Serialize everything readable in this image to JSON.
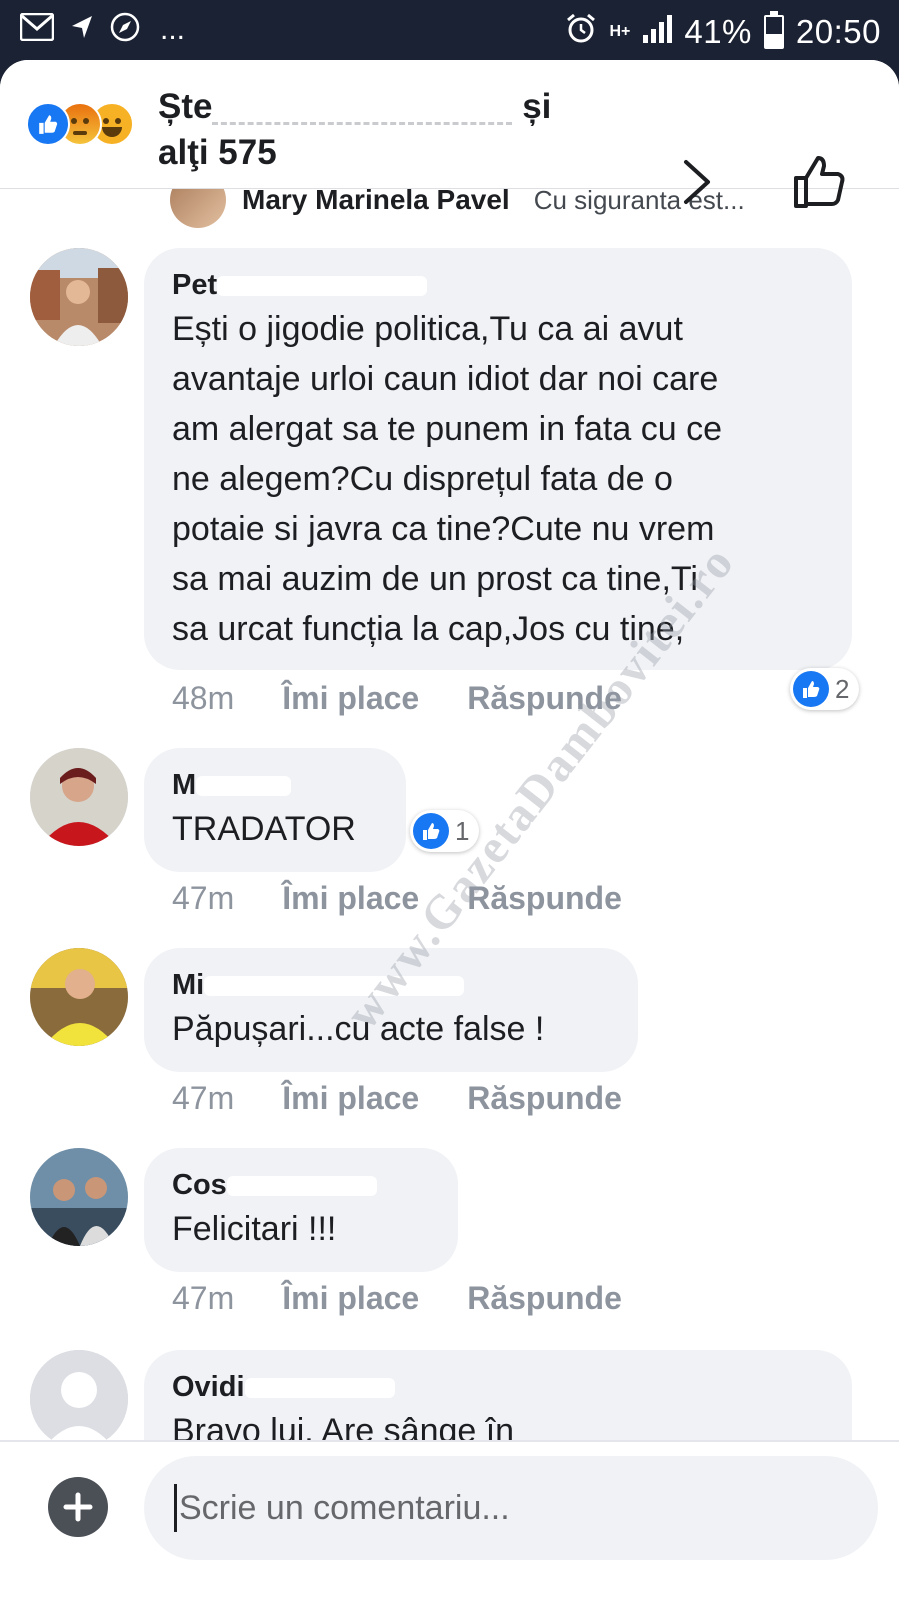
{
  "status_bar": {
    "network": "H+",
    "battery": "41%",
    "time": "20:50",
    "overflow": "..."
  },
  "header": {
    "title_start": "Ște",
    "title_end": "și",
    "title_line2": "alţi 575",
    "reactions": [
      "like",
      "angry",
      "haha"
    ]
  },
  "previous_reply": {
    "name": "Mary Marinela Pavel",
    "text": "Cu siguranta est..."
  },
  "comments": [
    {
      "author_visible": "Pet",
      "text": "Ești o jigodie politica,Tu ca ai avut\navantaje urloi caun idiot dar noi care\nam alergat sa te punem in fata cu ce\nne alegem?Cu disprețul fata de o\npotaie si javra ca tine?Cute nu vrem\nsa mai auzim de un prost ca tine,Ti\nsa urcat funcția la cap,Jos cu tine,",
      "time": "48m",
      "like_label": "Îmi place",
      "reply_label": "Răspunde",
      "likes": "2"
    },
    {
      "author_visible": "M",
      "text": "TRADATOR",
      "time": "47m",
      "like_label": "Îmi place",
      "reply_label": "Răspunde",
      "likes": "1"
    },
    {
      "author_visible": "Mi",
      "text": "Păpușari...cu acte false !",
      "time": "47m",
      "like_label": "Îmi place",
      "reply_label": "Răspunde"
    },
    {
      "author_visible": "Cos",
      "text": "Felicitari !!!",
      "time": "47m",
      "like_label": "Îmi place",
      "reply_label": "Răspunde"
    },
    {
      "author_visible": "Ovidi",
      "text": "Bravo lui. Are sânge în"
    }
  ],
  "watermark": "www.GazetaDambovitei.ro",
  "composer": {
    "placeholder": "Scrie un comentariu..."
  },
  "colors": {
    "accent": "#1877f2",
    "bubble": "#f0f2f5",
    "meta": "#8d949e",
    "status_bar": "#1b2233"
  }
}
